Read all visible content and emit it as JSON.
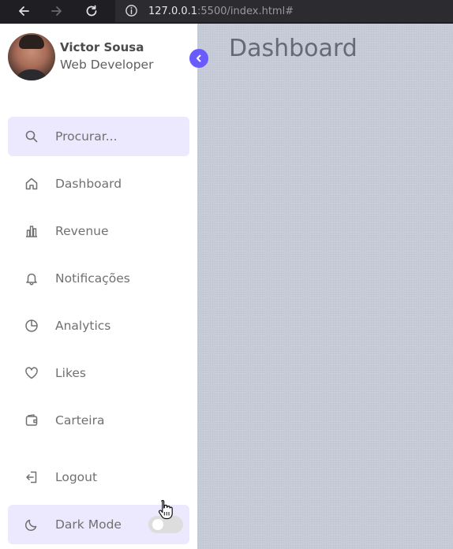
{
  "browser": {
    "url_host": "127.0.0.1",
    "url_path": ":5500/index.html#"
  },
  "profile": {
    "name": "Victor Sousa",
    "role": "Web Developer"
  },
  "search": {
    "placeholder": "Procurar..."
  },
  "menu": {
    "items": [
      {
        "label": "Dashboard",
        "icon": "home-icon"
      },
      {
        "label": "Revenue",
        "icon": "bar-chart-icon"
      },
      {
        "label": "Notificações",
        "icon": "bell-icon"
      },
      {
        "label": "Analytics",
        "icon": "pie-chart-icon"
      },
      {
        "label": "Likes",
        "icon": "heart-icon"
      },
      {
        "label": "Carteira",
        "icon": "wallet-icon"
      }
    ]
  },
  "bottom": {
    "logout_label": "Logout",
    "dark_mode_label": "Dark Mode",
    "dark_mode_on": false
  },
  "main": {
    "title": "Dashboard"
  },
  "colors": {
    "accent": "#695cfe",
    "accent_light": "#ece9ff",
    "main_bg": "#c7ccd8"
  }
}
